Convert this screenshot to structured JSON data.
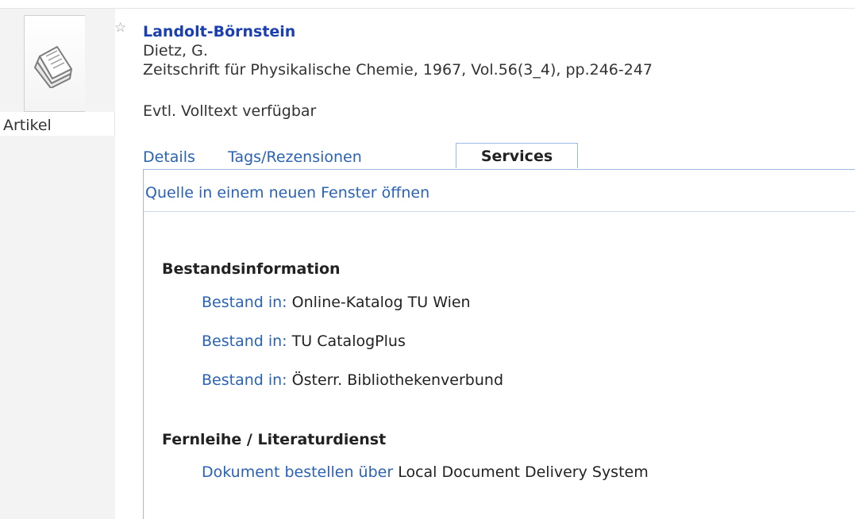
{
  "record": {
    "type_label": "Artikel",
    "title": "Landolt-Börnstein",
    "author": "Dietz, G.",
    "source": "Zeitschrift für Physikalische Chemie, 1967, Vol.56(3_4), pp.246-247",
    "availability": "Evtl. Volltext verfügbar",
    "star_glyph": "☆"
  },
  "tabs": {
    "details": "Details",
    "tags": "Tags/Rezensionen",
    "services": "Services",
    "active": "Services"
  },
  "services": {
    "open_link": "Quelle in einem neuen Fenster öffnen",
    "holdings_heading": "Bestandsinformation",
    "holdings": [
      {
        "label": "Bestand in:",
        "value": "Online-Katalog TU Wien"
      },
      {
        "label": "Bestand in:",
        "value": "TU CatalogPlus"
      },
      {
        "label": "Bestand in:",
        "value": "Österr. Bibliothekenverbund"
      }
    ],
    "ill_heading": "Fernleihe / Literaturdienst",
    "ill": {
      "label": "Dokument bestellen über",
      "value": "Local Document Delivery System"
    }
  },
  "colors": {
    "title": "#1a3fb0",
    "link": "#2a63b6",
    "tab_border": "#9bbbe4",
    "left_column": "#f3f3f3"
  }
}
